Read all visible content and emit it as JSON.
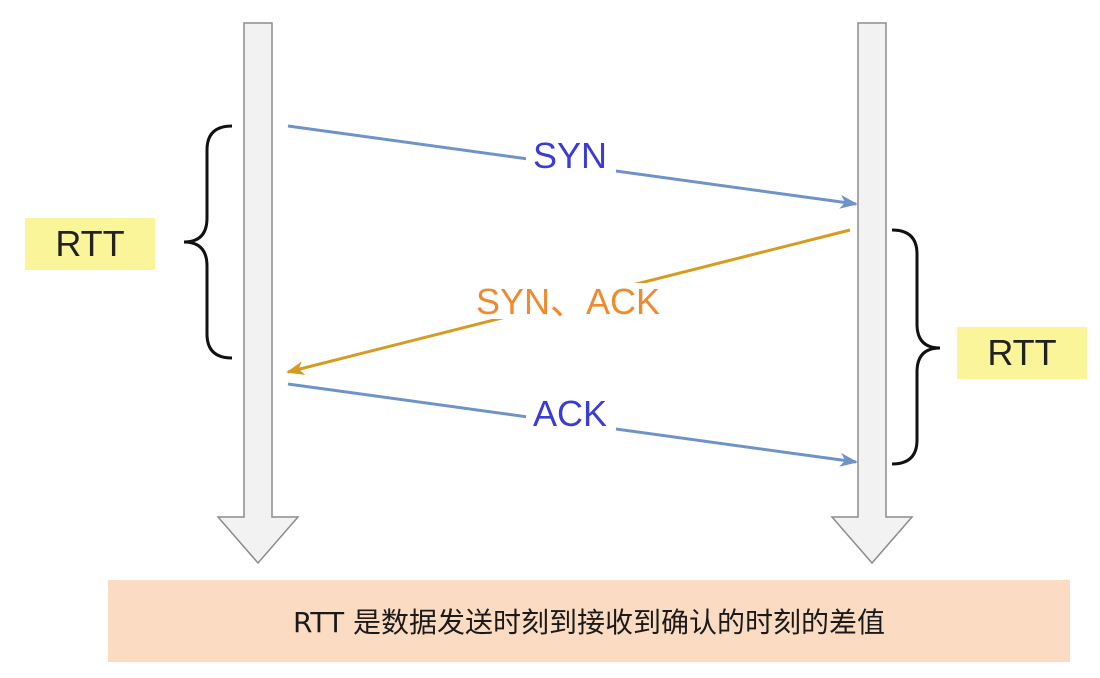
{
  "colors": {
    "syn": "#3b3bd6",
    "syn_line": "#6f93c9",
    "synack": "#ef8a2f",
    "synack_line": "#d69b22",
    "ack": "#3b3bd6",
    "ack_line": "#6f93c9",
    "rtt_bg": "#fbf59a",
    "caption_bg": "#fbdcc3"
  },
  "messages": {
    "syn": "SYN",
    "synack": "SYN、ACK",
    "ack": "ACK"
  },
  "rtt": {
    "left_label": "RTT",
    "right_label": "RTT"
  },
  "caption": "RTT 是数据发送时刻到接收到确认的时刻的差值"
}
